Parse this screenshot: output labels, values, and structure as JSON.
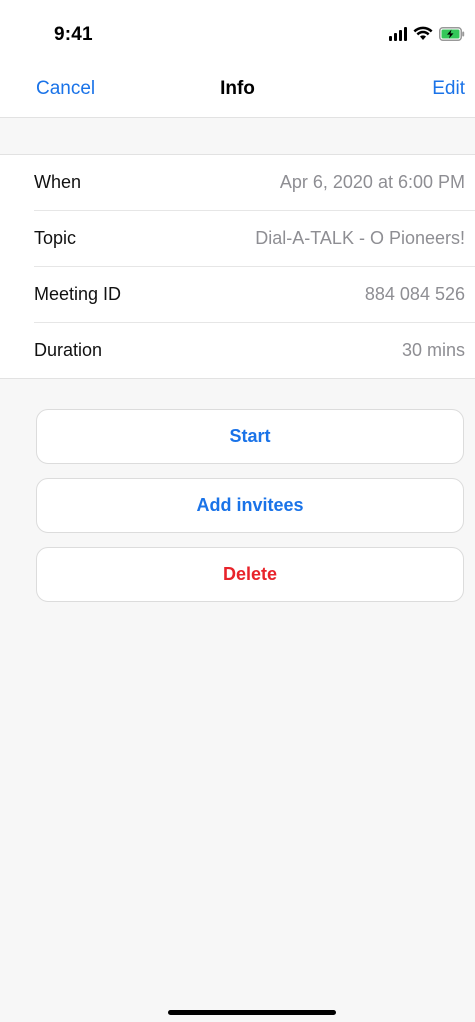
{
  "status_bar": {
    "time": "9:41",
    "icons": [
      "signal-icon",
      "wifi-icon",
      "battery-charging-icon"
    ]
  },
  "nav": {
    "cancel_label": "Cancel",
    "title": "Info",
    "edit_label": "Edit"
  },
  "info": {
    "rows": [
      {
        "label": "When",
        "value": "Apr 6, 2020 at 6:00 PM"
      },
      {
        "label": "Topic",
        "value": "Dial-A-TALK - O Pioneers!"
      },
      {
        "label": "Meeting ID",
        "value": "884 084 526"
      },
      {
        "label": "Duration",
        "value": "30 mins"
      }
    ]
  },
  "actions": {
    "start_label": "Start",
    "add_invitees_label": "Add invitees",
    "delete_label": "Delete"
  },
  "colors": {
    "accent": "#1a73e8",
    "destructive": "#e8232a",
    "secondary_text": "#8e8e93",
    "background": "#f7f7f7",
    "battery_charge": "#34c759"
  }
}
